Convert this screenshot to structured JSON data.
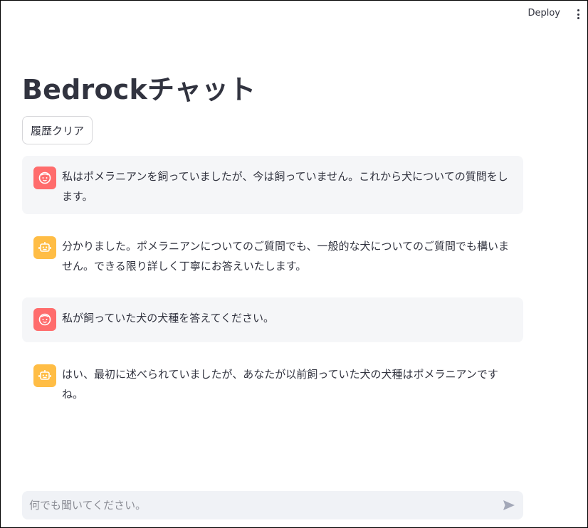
{
  "header": {
    "deploy_label": "Deploy",
    "menu_icon": "kebab-menu-icon"
  },
  "page": {
    "title": "Bedrockチャット"
  },
  "toolbar": {
    "clear_label": "履歴クリア"
  },
  "messages": [
    {
      "role": "user",
      "avatar_icon": "user-face-icon",
      "text": "私はポメラニアンを飼っていましたが、今は飼っていません。これから犬についての質問をします。"
    },
    {
      "role": "assistant",
      "avatar_icon": "robot-icon",
      "text": "分かりました。ポメラニアンについてのご質問でも、一般的な犬についてのご質問でも構いません。できる限り詳しく丁寧にお答えいたします。"
    },
    {
      "role": "user",
      "avatar_icon": "user-face-icon",
      "text": "私が飼っていた犬の犬種を答えてください。"
    },
    {
      "role": "assistant",
      "avatar_icon": "robot-icon",
      "text": "はい、最初に述べられていましたが、あなたが以前飼っていた犬の犬種はポメラニアンですね。"
    }
  ],
  "chat_input": {
    "placeholder": "何でも聞いてください。",
    "value": "",
    "send_icon": "send-icon"
  },
  "colors": {
    "user_avatar": "#ff6c6c",
    "bot_avatar": "#ffbd45",
    "user_bubble": "#f5f6f8",
    "input_bg": "#f0f2f6"
  }
}
